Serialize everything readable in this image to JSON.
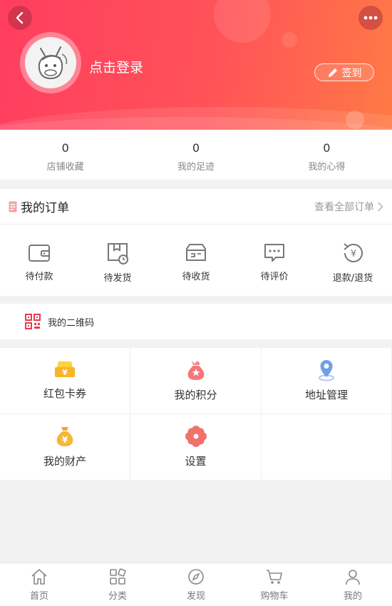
{
  "header": {
    "login_text": "点击登录",
    "signin_label": "签到"
  },
  "stats": [
    {
      "value": "0",
      "label": "店铺收藏"
    },
    {
      "value": "0",
      "label": "我的足迹"
    },
    {
      "value": "0",
      "label": "我的心得"
    }
  ],
  "orders": {
    "title": "我的订单",
    "view_all": "查看全部订单",
    "items": [
      {
        "label": "待付款",
        "icon": "wallet-icon"
      },
      {
        "label": "待发货",
        "icon": "package-clock-icon"
      },
      {
        "label": "待收货",
        "icon": "delivery-box-icon"
      },
      {
        "label": "待评价",
        "icon": "comment-icon"
      },
      {
        "label": "退款/退货",
        "icon": "refund-icon"
      }
    ]
  },
  "qr": {
    "label": "我的二维码"
  },
  "services": [
    {
      "label": "红包卡券",
      "icon": "coupon-icon"
    },
    {
      "label": "我的积分",
      "icon": "points-bag-icon"
    },
    {
      "label": "地址管理",
      "icon": "location-pin-icon"
    },
    {
      "label": "我的财产",
      "icon": "money-bag-icon"
    },
    {
      "label": "设置",
      "icon": "settings-flower-icon"
    }
  ],
  "tabbar": [
    {
      "label": "首页",
      "icon": "home-icon"
    },
    {
      "label": "分类",
      "icon": "category-icon"
    },
    {
      "label": "发现",
      "icon": "compass-icon"
    },
    {
      "label": "购物车",
      "icon": "cart-icon"
    },
    {
      "label": "我的",
      "icon": "user-icon"
    }
  ],
  "colors": {
    "accent": "#ff4d5e",
    "header_end": "#ff7a45"
  }
}
